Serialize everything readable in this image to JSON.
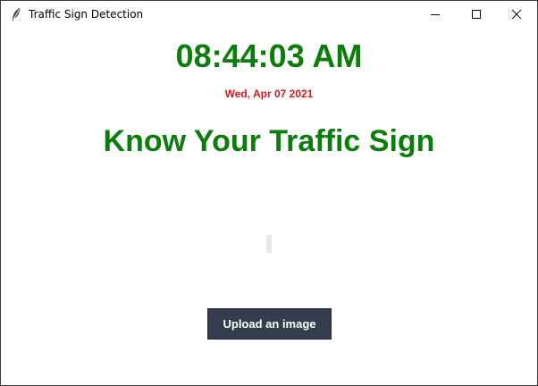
{
  "window": {
    "title": "Traffic Sign Detection",
    "icon": "feather-icon"
  },
  "controls": {
    "minimize_icon": "minimize-icon",
    "maximize_icon": "maximize-icon",
    "close_icon": "close-icon"
  },
  "clock": {
    "time": "08:44:03 AM",
    "date": "Wed, Apr 07 2021"
  },
  "main": {
    "heading": "Know Your Traffic Sign",
    "upload_label": "Upload an image"
  },
  "colors": {
    "clock": "#0a7d0a",
    "date": "#d61818",
    "heading": "#0a7d0a",
    "button_bg": "#353c4d",
    "button_text": "#ffffff"
  }
}
